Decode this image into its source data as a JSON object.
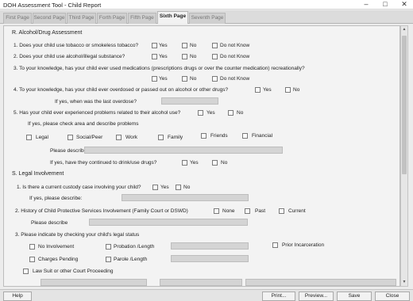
{
  "window": {
    "title": "DOH Assessment Tool - Child Report",
    "minimize": "–",
    "maximize": "□",
    "close": "✕"
  },
  "tabs": [
    "First Page",
    "Second Page",
    "Third Page",
    "Forth Page",
    "Fifth Page",
    "Sixth Page",
    "Seventh Page"
  ],
  "section_r": {
    "heading": "R.  Alcohol/Drug Assessment",
    "q1": "1. Does your child use tobacco or smokeless tobacco?",
    "q2": "2. Does your child use alcohol/illegal substance?",
    "q3": "3. To your knowledge, has your child ever used medications (prescriptions drugs or over the counter medication) recreationally?",
    "q4": "4. To your knowledge, has your child ever overdosed or passed out on alcohol or other drugs?",
    "q4_followup": "If yes, when was the last overdose?",
    "q5": "5. Has your child ever experienced problems related to their alcohol use?",
    "q5_followup": "If yes, please check area and describe problems",
    "areas": [
      "Legal",
      "Social/Peer",
      "Work",
      "Family",
      "Friends",
      "Financial"
    ],
    "describe": "Please describe:",
    "continued": "If yes, have they continued to drink/use drugs?"
  },
  "answers": {
    "yes": "Yes",
    "no": "No",
    "dont_know": "Do not Know",
    "none": "None",
    "past": "Past",
    "current": "Current"
  },
  "section_s": {
    "heading": "S.  Legal Involvement",
    "q1": "1. Is there a current custody case involving your child?",
    "q1_followup": "If yes, please describe:",
    "q2": "2. History of Child Protective Services Involvement (Family Court or DSWD)",
    "q2_describe": "Please describe",
    "q3": "3. Please indicate by checking your child's legal status",
    "status": {
      "no_involvement": "No Involvement",
      "probation": "Probation /Length",
      "prior_incarceration": "Prior Incarceration",
      "charges_pending": "Charges Pending",
      "parole": "Parole /Length",
      "lawsuit": "Law Suit or other Court Proceeding"
    }
  },
  "footer": {
    "help": "Help",
    "print": "Print...",
    "preview": "Preview...",
    "save": "Save",
    "close": "Close"
  }
}
